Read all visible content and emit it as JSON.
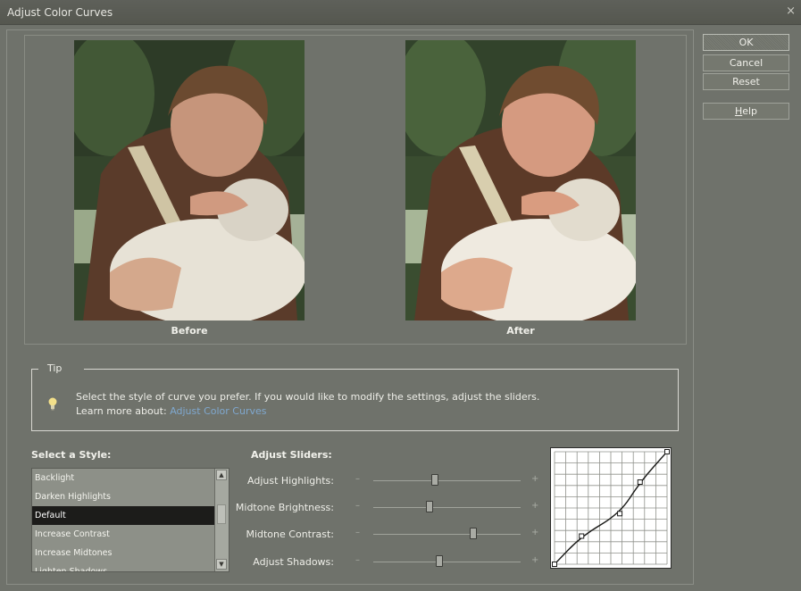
{
  "window": {
    "title": "Adjust Color Curves",
    "close_glyph": "×"
  },
  "buttons": {
    "ok": "OK",
    "cancel": "Cancel",
    "reset": "Reset",
    "help_prefix": "H",
    "help_rest": "elp"
  },
  "preview": {
    "before_label": "Before",
    "after_label": "After"
  },
  "tip": {
    "legend": "Tip",
    "text": "Select the style of curve you prefer. If you would like to modify the settings, adjust the sliders.",
    "learn_more_label": "Learn more about:",
    "link": "Adjust Color Curves"
  },
  "style_section": {
    "heading": "Select a Style:",
    "items": [
      "Backlight",
      "Darken Highlights",
      "Default",
      "Increase Contrast",
      "Increase Midtones",
      "Lighten Shadows"
    ],
    "selected": "Default"
  },
  "sliders_section": {
    "heading": "Adjust Sliders:",
    "minus": "–",
    "plus": "+",
    "sliders": [
      {
        "label": "Adjust Highlights:",
        "value": 0.42
      },
      {
        "label": "Midtone Brightness:",
        "value": 0.38
      },
      {
        "label": "Midtone Contrast:",
        "value": 0.68
      },
      {
        "label": "Adjust Shadows:",
        "value": 0.45
      }
    ]
  },
  "curve": {
    "points": [
      [
        0,
        0
      ],
      [
        0.24,
        0.25
      ],
      [
        0.58,
        0.45
      ],
      [
        0.76,
        0.73
      ],
      [
        1,
        1
      ]
    ]
  },
  "colors": {
    "background": "#6f726b",
    "selected_item": "#1c1c1a",
    "link": "#7fa8cf"
  },
  "icons": {
    "tip": "lightbulb-icon"
  }
}
